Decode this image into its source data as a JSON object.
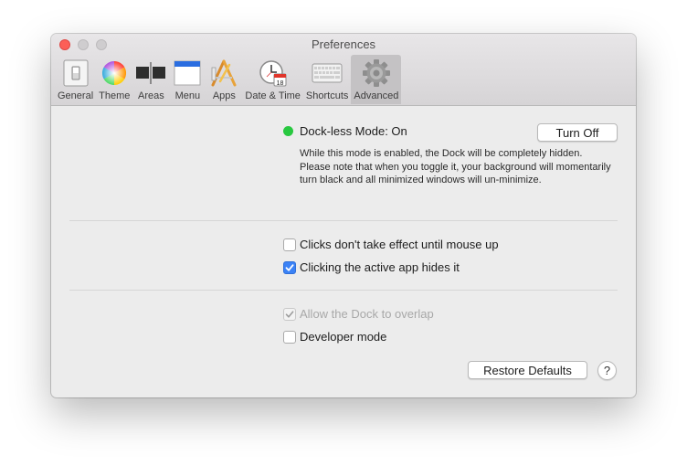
{
  "window": {
    "title": "Preferences"
  },
  "toolbar": {
    "items": [
      {
        "label": "General",
        "icon": "switch-icon"
      },
      {
        "label": "Theme",
        "icon": "color-wheel-icon"
      },
      {
        "label": "Areas",
        "icon": "areas-icon"
      },
      {
        "label": "Menu",
        "icon": "menu-bar-icon"
      },
      {
        "label": "Apps",
        "icon": "apps-icon"
      },
      {
        "label": "Date & Time",
        "icon": "clock-calendar-icon"
      },
      {
        "label": "Shortcuts",
        "icon": "keyboard-icon"
      },
      {
        "label": "Advanced",
        "icon": "gear-icon"
      }
    ],
    "selected": "Advanced",
    "calendar_day": "18"
  },
  "dockless": {
    "status": "Dock-less Mode: On",
    "status_color": "#28c840",
    "button": "Turn Off",
    "description": "While this mode is enabled, the Dock will be completely hidden. Please note that when you toggle it, your background will momentarily turn black and all minimized windows will un-minimize."
  },
  "options": {
    "mouse_up": {
      "label": "Clicks don't take effect until mouse up",
      "checked": false
    },
    "active_app": {
      "label": "Clicking the active app hides it",
      "checked": true
    },
    "overlap": {
      "label": "Allow the Dock to overlap",
      "checked": true,
      "disabled": true
    },
    "developer": {
      "label": "Developer mode",
      "checked": false
    }
  },
  "footer": {
    "restore": "Restore Defaults",
    "help": "?"
  }
}
